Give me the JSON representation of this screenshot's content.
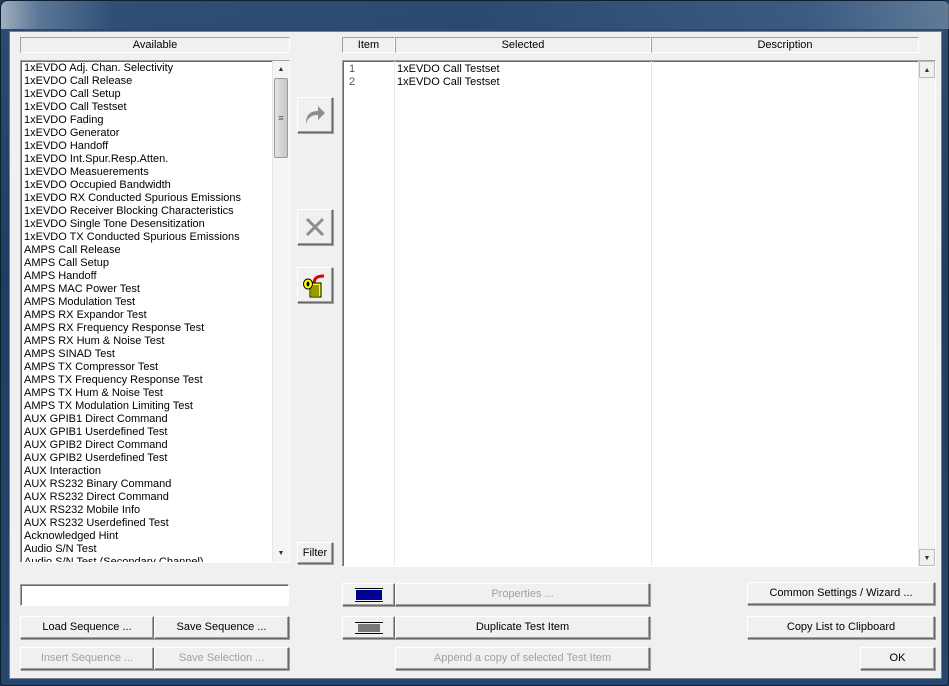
{
  "window": {
    "title": ""
  },
  "available": {
    "header": "Available",
    "items": [
      "1xEVDO Adj. Chan. Selectivity",
      "1xEVDO Call Release",
      "1xEVDO Call Setup",
      "1xEVDO Call Testset",
      "1xEVDO Fading",
      "1xEVDO Generator",
      "1xEVDO Handoff",
      "1xEVDO Int.Spur.Resp.Atten.",
      "1xEVDO Measuerements",
      "1xEVDO Occupied Bandwidth",
      "1xEVDO RX Conducted Spurious Emissions",
      "1xEVDO Receiver Blocking Characteristics",
      "1xEVDO Single Tone Desensitization",
      "1xEVDO TX Conducted Spurious Emissions",
      "AMPS Call Release",
      "AMPS Call Setup",
      "AMPS Handoff",
      "AMPS MAC Power Test",
      "AMPS Modulation Test",
      "AMPS RX Expandor Test",
      "AMPS RX Frequency Response Test",
      "AMPS RX Hum & Noise Test",
      "AMPS SINAD Test",
      "AMPS TX Compressor Test",
      "AMPS TX Frequency Response Test",
      "AMPS TX Hum & Noise Test",
      "AMPS TX Modulation Limiting Test",
      "AUX GPIB1 Direct Command",
      "AUX GPIB1 Userdefined Test",
      "AUX GPIB2 Direct Command",
      "AUX GPIB2 Userdefined Test",
      "AUX Interaction",
      "AUX RS232 Binary Command",
      "AUX RS232 Direct Command",
      "AUX RS232 Mobile Info",
      "AUX RS232 Userdefined Test",
      "Acknowledged Hint",
      "Audio S/N Test",
      "Audio S/N Test (Secondary Channel)"
    ],
    "scroll_position": 0.0
  },
  "selected": {
    "columns": {
      "item": "Item",
      "selected": "Selected",
      "description": "Description"
    },
    "rows": [
      {
        "item": "1",
        "selected": "1xEVDO Call Testset",
        "description": ""
      },
      {
        "item": "2",
        "selected": "1xEVDO Call Testset",
        "description": ""
      }
    ]
  },
  "middle": {
    "add_icon": "redo-arrow-icon",
    "remove_icon": "x-delete-icon",
    "clear_icon": "trash-can-icon",
    "filter_label": "Filter"
  },
  "filter_input": {
    "value": "",
    "placeholder": ""
  },
  "buttons": {
    "load_sequence": "Load Sequence ...",
    "save_sequence": "Save Sequence ...",
    "insert_sequence": "Insert Sequence ...",
    "save_selection": "Save Selection ...",
    "properties": "Properties ...",
    "duplicate": "Duplicate Test Item",
    "append_copy": "Append a copy of selected Test Item",
    "common_settings": "Common Settings / Wizard ...",
    "copy_list": "Copy List to Clipboard",
    "ok": "OK"
  },
  "colors": {
    "swatch_fill": "#0000a0",
    "client_bg": "#f0f0f0",
    "disabled_text": "#a0a0a0",
    "frame": "#1f3d62"
  }
}
